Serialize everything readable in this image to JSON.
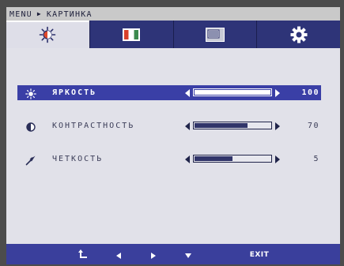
{
  "breadcrumb": {
    "root": "MENU",
    "separator_icon": "triangle-right-icon",
    "current": "КАРТИНКА"
  },
  "tabs": [
    {
      "id": "picture",
      "icon": "brightness-sun-icon",
      "active": true
    },
    {
      "id": "color",
      "icon": "color-bars-icon",
      "active": false
    },
    {
      "id": "display",
      "icon": "display-window-icon",
      "active": false
    },
    {
      "id": "setup",
      "icon": "gear-icon",
      "active": false
    }
  ],
  "settings": [
    {
      "id": "brightness",
      "icon": "sun-icon",
      "label": "ЯРКОСТЬ",
      "value": "100",
      "level": 1.0,
      "selected": true
    },
    {
      "id": "contrast",
      "icon": "contrast-icon",
      "label": "КОНТРАСТНОСТЬ",
      "value": "70",
      "level": 0.7,
      "selected": false
    },
    {
      "id": "sharpness",
      "icon": "sharpness-icon",
      "label": "ЧЕТКОСТЬ",
      "value": "5",
      "level": 0.5,
      "selected": false
    }
  ],
  "bottom_nav": {
    "back_icon": "return-icon",
    "left_icon": "arrow-left-icon",
    "right_icon": "arrow-right-icon",
    "down_icon": "arrow-down-icon",
    "exit_label": "EXIT"
  },
  "colors": {
    "frame": "#1f2239",
    "tabbar": "#2e3478",
    "panel": "#e1e1e9",
    "selected_row": "#3a3fa6",
    "bottom_bar": "#3a3f9c",
    "text": "#3b3d58"
  }
}
